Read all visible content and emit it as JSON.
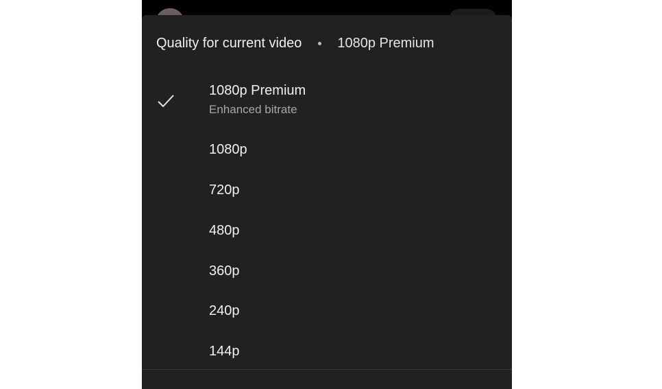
{
  "sheet": {
    "title": "Quality for current video",
    "current_value": "1080p Premium"
  },
  "options": [
    {
      "label": "1080p Premium",
      "sublabel": "Enhanced bitrate",
      "selected": true
    },
    {
      "label": "1080p"
    },
    {
      "label": "720p"
    },
    {
      "label": "480p"
    },
    {
      "label": "360p"
    },
    {
      "label": "240p"
    },
    {
      "label": "144p"
    }
  ],
  "colors": {
    "sheet_background": "#212121",
    "text_primary": "#f1f1f1",
    "text_secondary": "#a8a8a8"
  },
  "icons": {
    "selected_indicator": "check-icon"
  }
}
